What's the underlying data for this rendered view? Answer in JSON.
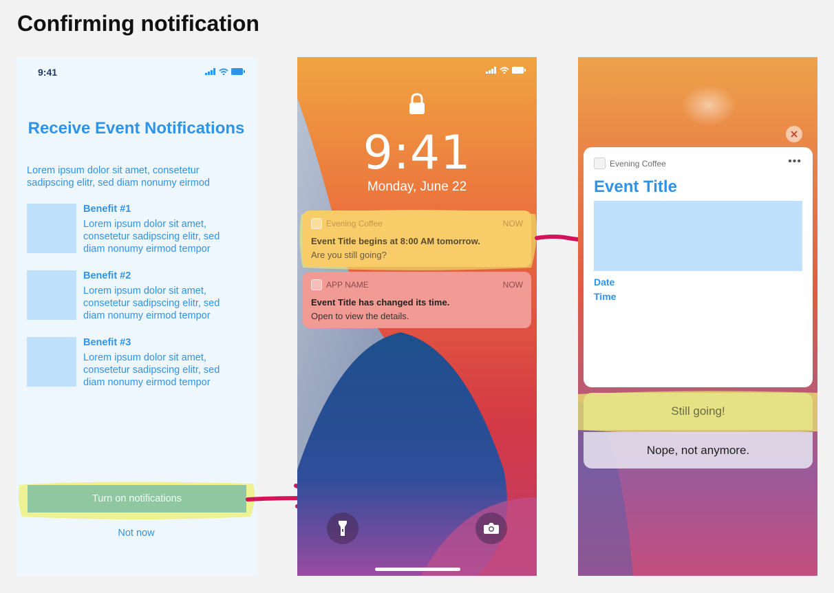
{
  "page": {
    "title": "Confirming notification"
  },
  "colors": {
    "accent": "#2f93e8",
    "highlight": "#eef06e",
    "arrow": "#d4145a",
    "button_green": "#8fc8a0"
  },
  "onboarding": {
    "status_time": "9:41",
    "heading": "Receive Event Notifications",
    "intro": "Lorem ipsum dolor sit amet, consetetur sadipscing elitr, sed diam nonumy eirmod",
    "benefits": [
      {
        "title": "Benefit #1",
        "text": "Lorem ipsum dolor sit amet, consetetur sadipscing elitr, sed diam nonumy eirmod tempor"
      },
      {
        "title": "Benefit #2",
        "text": "Lorem ipsum dolor sit amet, consetetur sadipscing elitr, sed diam nonumy eirmod tempor"
      },
      {
        "title": "Benefit #3",
        "text": "Lorem ipsum dolor sit amet, consetetur sadipscing elitr, sed diam nonumy eirmod tempor"
      }
    ],
    "primary_button": "Turn on notifications",
    "secondary_button": "Not now"
  },
  "lockscreen": {
    "time": "9:41",
    "date": "Monday, June 22",
    "notifications": [
      {
        "app": "Evening Coffee",
        "time": "NOW",
        "line1": "Event Title begins at 8:00 AM tomorrow.",
        "line2": "Are you still going?"
      },
      {
        "app": "APP NAME",
        "time": "NOW",
        "line1": "Event Title has changed its time.",
        "line2": "Open to view the details."
      }
    ],
    "icons": {
      "flashlight": "flashlight-icon",
      "camera": "camera-icon",
      "lock": "lock-icon"
    }
  },
  "expanded": {
    "app": "Evening Coffee",
    "more": "•••",
    "title": "Event Title",
    "date_label": "Date",
    "time_label": "Time",
    "action_primary": "Still going!",
    "action_secondary": "Nope, not anymore."
  }
}
